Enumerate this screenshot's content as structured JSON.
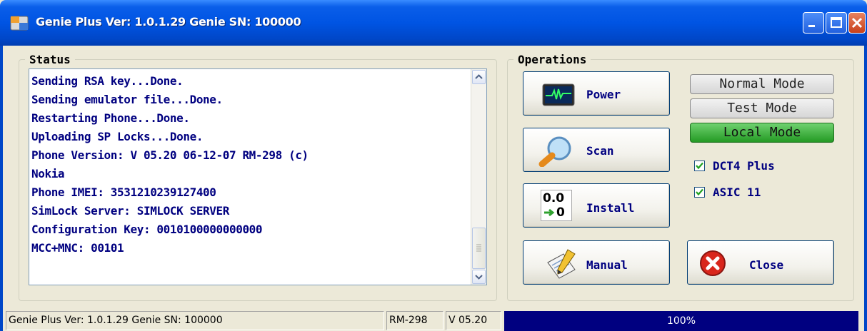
{
  "window": {
    "title": "Genie Plus Ver: 1.0.1.29 Genie SN: 100000"
  },
  "status": {
    "legend": "Status",
    "log": [
      "Sending RSA key...Done.",
      "Sending emulator file...Done.",
      "Restarting Phone...Done.",
      "Uploading SP Locks...Done.",
      "Phone Version: V 05.20 06-12-07 RM-298 (c)",
      "Nokia",
      "Phone IMEI: 3531210239127400",
      "SimLock Server: SIMLOCK SERVER",
      "Configuration Key: 0010100000000000",
      "MCC+MNC: 00101"
    ]
  },
  "operations": {
    "legend": "Operations",
    "buttons": {
      "power": "Power",
      "scan": "Scan",
      "install": "Install",
      "manual": "Manual",
      "close": "Close"
    },
    "install_icon_text": [
      "0.0",
      "0"
    ],
    "modes": [
      {
        "label": "Normal Mode",
        "active": false
      },
      {
        "label": "Test Mode",
        "active": false
      },
      {
        "label": "Local Mode",
        "active": true
      }
    ],
    "checkboxes": [
      {
        "label": "DCT4 Plus",
        "checked": true
      },
      {
        "label": "ASIC 11",
        "checked": true
      }
    ]
  },
  "statusbar": {
    "app": "Genie Plus Ver: 1.0.1.29 Genie SN: 100000",
    "model": "RM-298",
    "version": "V 05.20",
    "progress_text": "100%",
    "progress_value": 1.0
  },
  "colors": {
    "title_bar": "#0054e3",
    "log_text": "#000080",
    "active_mode": "#249a24",
    "progress": "#000080"
  },
  "icons": {
    "app": "folder-app-icon",
    "power": "oscilloscope-icon",
    "scan": "magnifier-icon",
    "install": "counter-arrow-icon",
    "manual": "pen-notepad-icon",
    "close": "red-x-icon"
  }
}
